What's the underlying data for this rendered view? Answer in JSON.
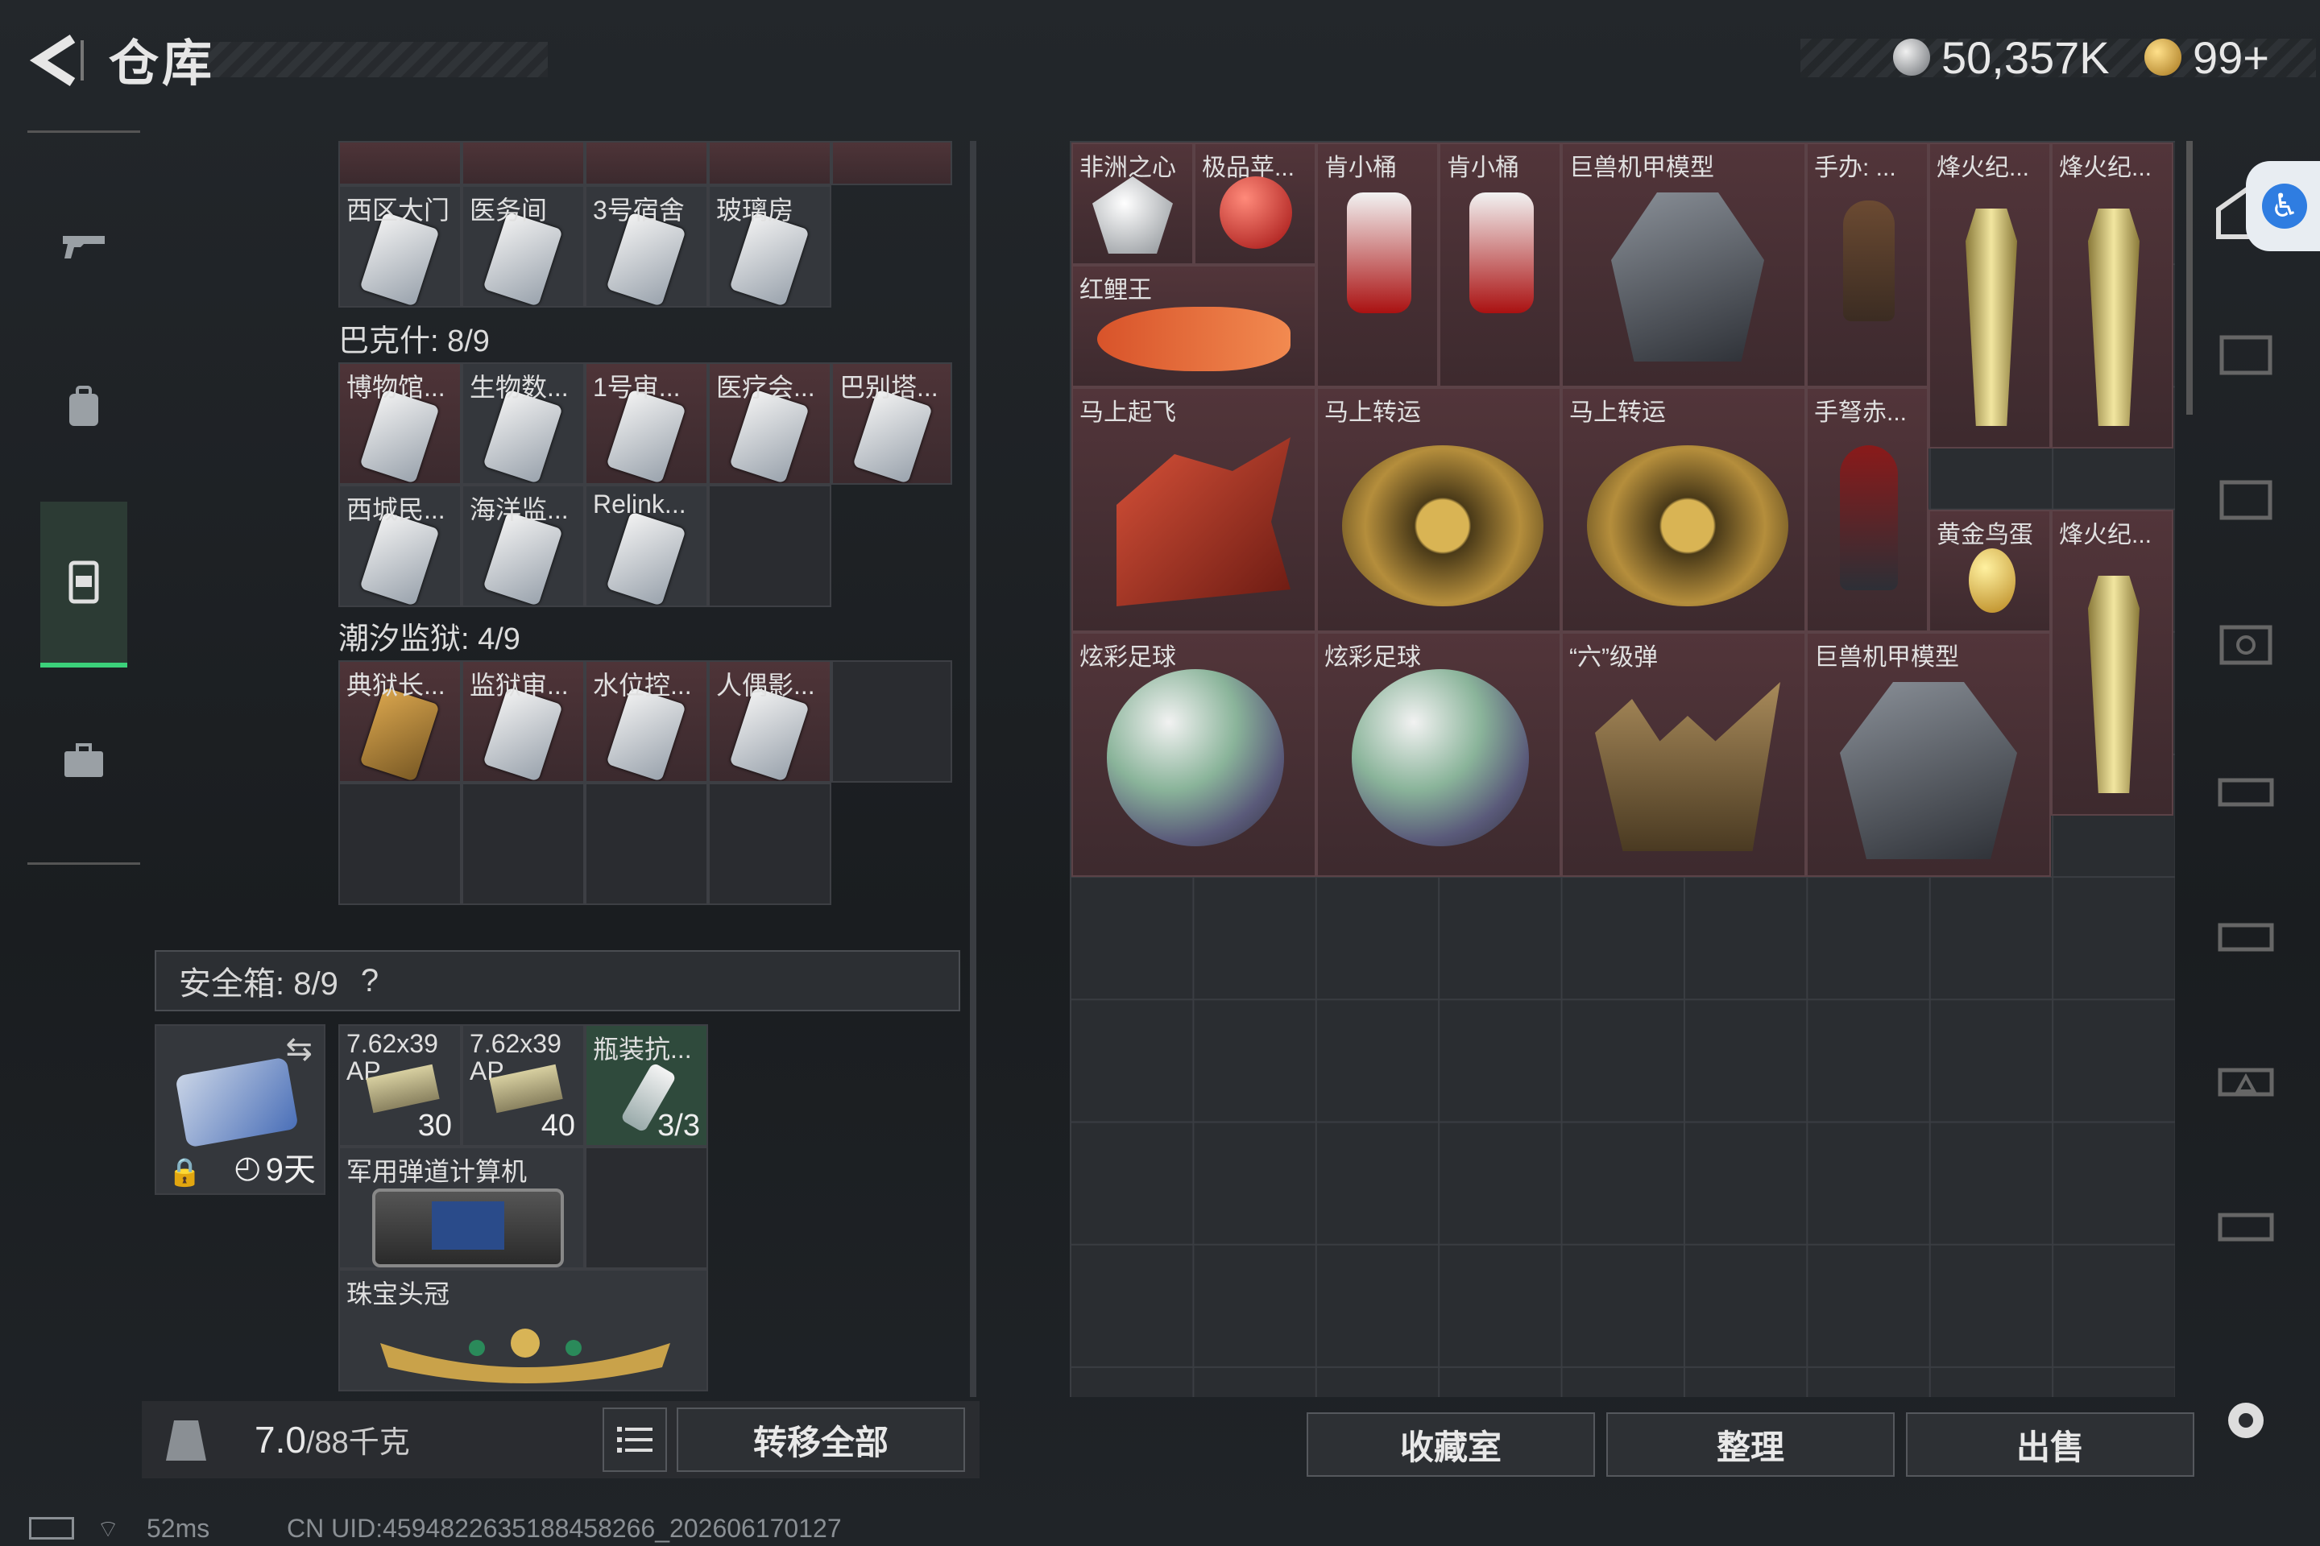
{
  "header": {
    "title": "仓库",
    "currency_1": "50,357K",
    "currency_2": "99+"
  },
  "sidebar": {
    "items": [
      {
        "icon": "gun-icon"
      },
      {
        "icon": "backpack-icon"
      },
      {
        "icon": "container-icon",
        "active": true
      },
      {
        "icon": "briefcase-icon"
      }
    ]
  },
  "left": {
    "top_row_labels": [
      "西区大门",
      "医务间",
      "3号宿舍",
      "玻璃房"
    ],
    "section_bakesh": "巴克什: 8/9",
    "bakesh_items": [
      "博物馆...",
      "生物数...",
      "1号审...",
      "医疗会...",
      "巴别塔...",
      "西城民...",
      "海洋监...",
      "Relink..."
    ],
    "section_chaoxi": "潮汐监狱: 4/9",
    "chaoxi_items": [
      "典狱长...",
      "监狱审...",
      "水位控...",
      "人偶影..."
    ],
    "safebox_label": "安全箱: 8/9",
    "safebox_help": "?",
    "safebox_timer": "9天",
    "safe_items": [
      {
        "label": "7.62x39",
        "sub": "AP",
        "count": "30"
      },
      {
        "label": "7.62x39",
        "sub": "AP",
        "count": "40"
      },
      {
        "label": "瓶装抗...",
        "count": "3/3"
      },
      {
        "label": "军用弹道计算机"
      },
      {
        "label": "珠宝头冠"
      }
    ],
    "weight": "7.0",
    "weight_max": "/88千克",
    "transfer_all": "转移全部"
  },
  "right": {
    "items": [
      {
        "label": "非洲之心"
      },
      {
        "label": "极品苹..."
      },
      {
        "label": "肯小桶"
      },
      {
        "label": "肯小桶"
      },
      {
        "label": "巨兽机甲模型"
      },
      {
        "label": "手办: ..."
      },
      {
        "label": "烽火纪..."
      },
      {
        "label": "烽火纪..."
      },
      {
        "label": "红鲤王"
      },
      {
        "label": "马上起飞"
      },
      {
        "label": "马上转运"
      },
      {
        "label": "马上转运"
      },
      {
        "label": "手弩赤..."
      },
      {
        "label": "黄金鸟蛋"
      },
      {
        "label": "烽火纪..."
      },
      {
        "label": "炫彩足球"
      },
      {
        "label": "炫彩足球"
      },
      {
        "label": "“六”级弹"
      },
      {
        "label": "巨兽机甲模型"
      }
    ],
    "btn_collection": "收藏室",
    "btn_sort": "整理",
    "btn_sell": "出售"
  },
  "status": {
    "ping": "52ms",
    "uid": "CN UID:4594822635188458266_202606170127"
  },
  "colors": {
    "item_bg": "#4a3236",
    "active_green": "#3bd17a",
    "accessibility_blue": "#2f7de1"
  }
}
